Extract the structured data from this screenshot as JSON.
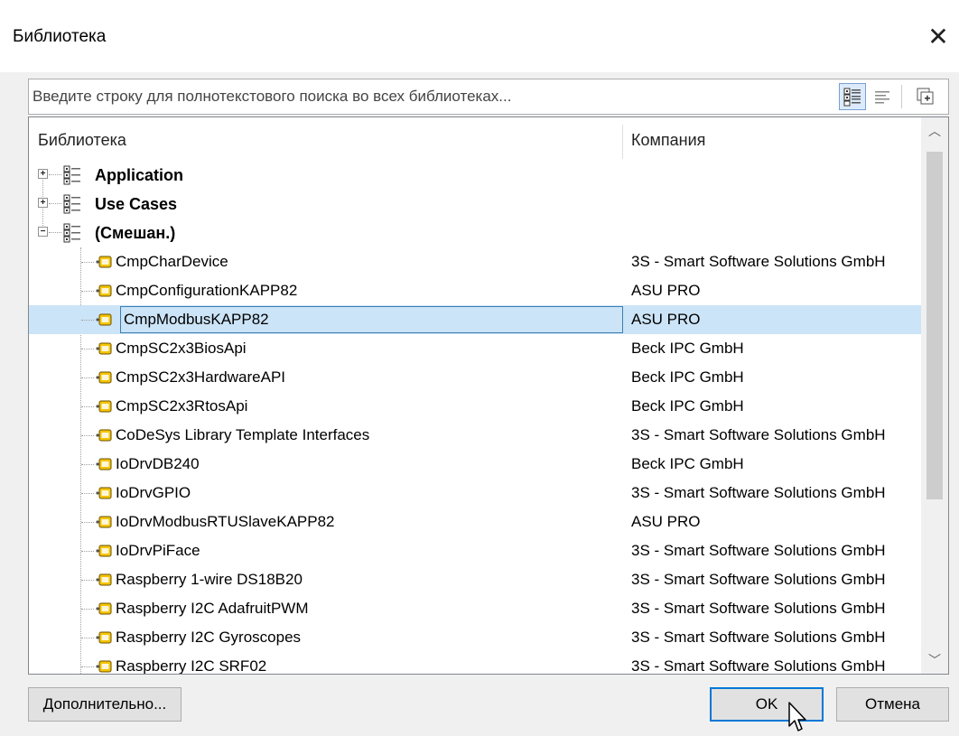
{
  "window": {
    "title": "Библиотека",
    "close_label": "✕"
  },
  "search": {
    "placeholder": "Введите строку для полнотекстового поиска во всех библиотеках..."
  },
  "toolbar": {
    "icons": [
      "category-view-icon",
      "list-view-icon",
      "details-icon"
    ]
  },
  "columns": {
    "library": "Библиотека",
    "company": "Компания"
  },
  "tree": {
    "groups": [
      {
        "label": "Application",
        "expander": "+"
      },
      {
        "label": "Use Cases",
        "expander": "+"
      },
      {
        "label": "(Смешан.)",
        "expander": "−"
      }
    ],
    "items": [
      {
        "name": "CmpCharDevice",
        "company": "3S - Smart Software Solutions GmbH"
      },
      {
        "name": "CmpConfigurationKAPP82",
        "company": "ASU PRO"
      },
      {
        "name": "CmpModbusKAPP82",
        "company": "ASU PRO",
        "selected": true
      },
      {
        "name": "CmpSC2x3BiosApi",
        "company": "Beck IPC GmbH"
      },
      {
        "name": "CmpSC2x3HardwareAPI",
        "company": "Beck IPC GmbH"
      },
      {
        "name": "CmpSC2x3RtosApi",
        "company": "Beck IPC GmbH"
      },
      {
        "name": "CoDeSys Library Template Interfaces",
        "company": "3S - Smart Software Solutions GmbH"
      },
      {
        "name": "IoDrvDB240",
        "company": "Beck IPC GmbH"
      },
      {
        "name": "IoDrvGPIO",
        "company": "3S - Smart Software Solutions GmbH"
      },
      {
        "name": "IoDrvModbusRTUSlaveKAPP82",
        "company": "ASU PRO"
      },
      {
        "name": "IoDrvPiFace",
        "company": "3S - Smart Software Solutions GmbH"
      },
      {
        "name": "Raspberry 1-wire DS18B20",
        "company": "3S - Smart Software Solutions GmbH"
      },
      {
        "name": "Raspberry I2C AdafruitPWM",
        "company": "3S - Smart Software Solutions GmbH"
      },
      {
        "name": "Raspberry I2C Gyroscopes",
        "company": "3S - Smart Software Solutions GmbH"
      },
      {
        "name": "Raspberry I2C SRF02",
        "company": "3S - Smart Software Solutions GmbH"
      }
    ]
  },
  "buttons": {
    "advanced": "Дополнительно...",
    "ok": "OK",
    "cancel": "Отмена"
  },
  "colors": {
    "selection": "#cce4f7",
    "accent": "#0078d7"
  }
}
